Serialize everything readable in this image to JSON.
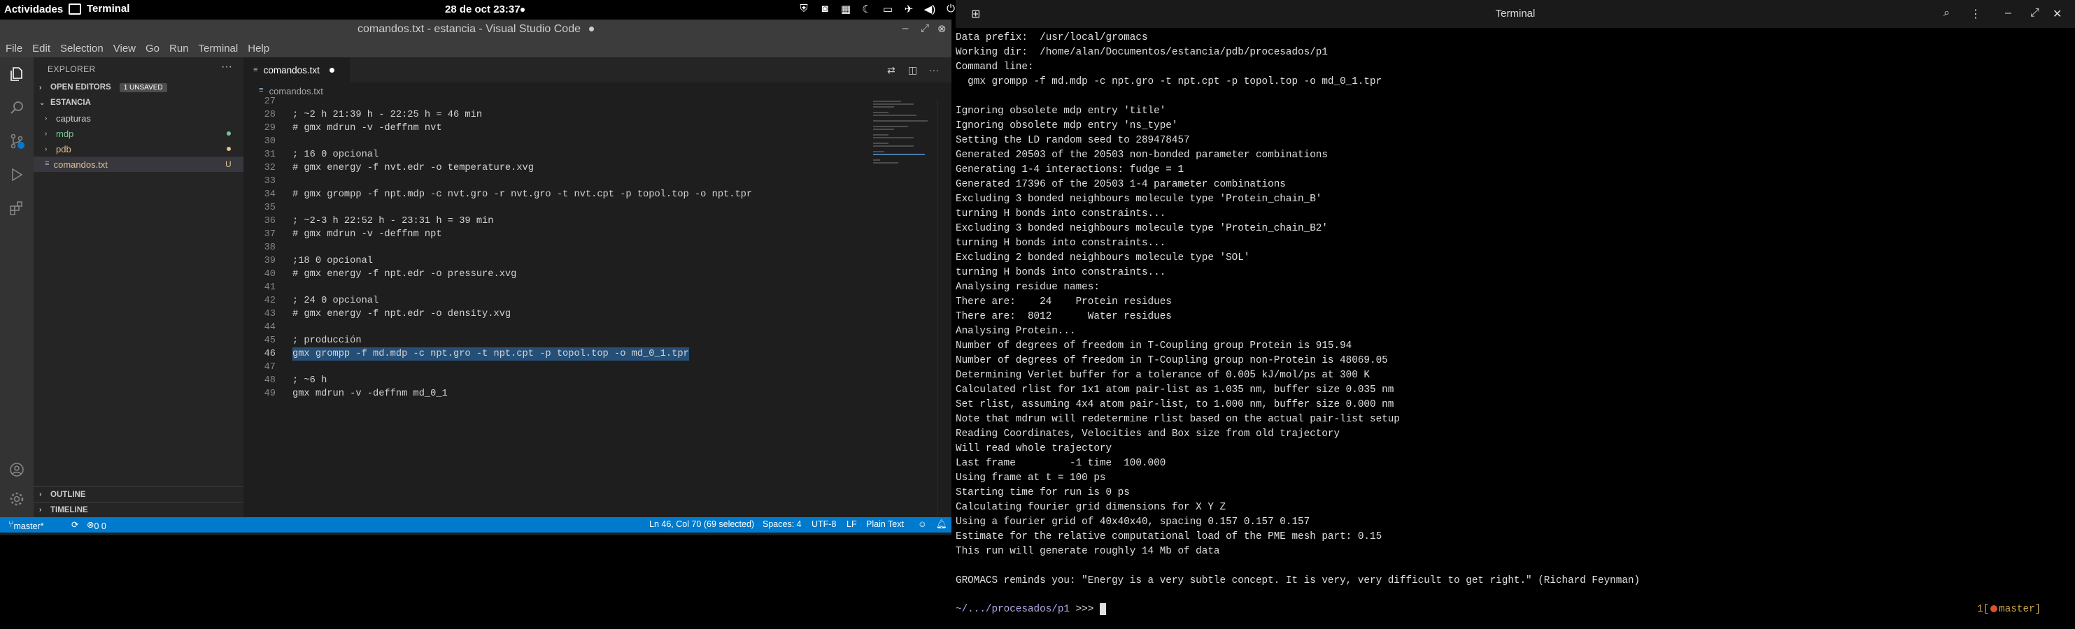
{
  "topbar": {
    "activities": "Actividades",
    "app_name": "Terminal",
    "clock": "28 de oct  23:37"
  },
  "vscode": {
    "title": "comandos.txt - estancia - Visual Studio Code",
    "menu": [
      "File",
      "Edit",
      "Selection",
      "View",
      "Go",
      "Run",
      "Terminal",
      "Help"
    ],
    "sidebar": {
      "header": "EXPLORER",
      "open_editors": "OPEN EDITORS",
      "unsaved_badge": "1 UNSAVED",
      "folder": "ESTANCIA",
      "items": [
        {
          "label": "capturas",
          "type": "folder",
          "color": "#cccccc"
        },
        {
          "label": "mdp",
          "type": "folder",
          "color": "#73c991"
        },
        {
          "label": "pdb",
          "type": "folder",
          "color": "#e2c08d"
        },
        {
          "label": "comandos.txt",
          "type": "file",
          "color": "#e2c08d",
          "mark": "U"
        }
      ],
      "outline": "OUTLINE",
      "timeline": "TIMELINE"
    },
    "tab": {
      "label": "comandos.txt"
    },
    "breadcrumb": "comandos.txt",
    "code_lines": [
      {
        "n": "27",
        "t": ""
      },
      {
        "n": "28",
        "t": "; ~2 h 21:39 h - 22:25 h = 46 min"
      },
      {
        "n": "29",
        "t": "# gmx mdrun -v -deffnm nvt"
      },
      {
        "n": "30",
        "t": ""
      },
      {
        "n": "31",
        "t": "; 16 0 opcional"
      },
      {
        "n": "32",
        "t": "# gmx energy -f nvt.edr -o temperature.xvg"
      },
      {
        "n": "33",
        "t": ""
      },
      {
        "n": "34",
        "t": "# gmx grompp -f npt.mdp -c nvt.gro -r nvt.gro -t nvt.cpt -p topol.top -o npt.tpr"
      },
      {
        "n": "35",
        "t": ""
      },
      {
        "n": "36",
        "t": "; ~2-3 h 22:52 h - 23:31 h = 39 min"
      },
      {
        "n": "37",
        "t": "# gmx mdrun -v -deffnm npt"
      },
      {
        "n": "38",
        "t": ""
      },
      {
        "n": "39",
        "t": ";18 0 opcional"
      },
      {
        "n": "40",
        "t": "# gmx energy -f npt.edr -o pressure.xvg"
      },
      {
        "n": "41",
        "t": ""
      },
      {
        "n": "42",
        "t": "; 24 0 opcional"
      },
      {
        "n": "43",
        "t": "# gmx energy -f npt.edr -o density.xvg"
      },
      {
        "n": "44",
        "t": ""
      },
      {
        "n": "45",
        "t": "; producción"
      },
      {
        "n": "46",
        "t": "gmx grompp -f md.mdp -c npt.gro -t npt.cpt -p topol.top -o md_0_1.tpr"
      },
      {
        "n": "47",
        "t": ""
      },
      {
        "n": "48",
        "t": "; ~6 h"
      },
      {
        "n": "49",
        "t": "gmx mdrun -v -deffnm md_0_1"
      }
    ],
    "status": {
      "branch": "master*",
      "problems": "0  0",
      "position": "Ln 46, Col 70 (69 selected)",
      "spaces": "Spaces: 4",
      "encoding": "UTF-8",
      "eol": "LF",
      "language": "Plain Text"
    }
  },
  "terminal": {
    "title": "Terminal",
    "lines": [
      "Data prefix:  /usr/local/gromacs",
      "Working dir:  /home/alan/Documentos/estancia/pdb/procesados/p1",
      "Command line:",
      "  gmx grompp -f md.mdp -c npt.gro -t npt.cpt -p topol.top -o md_0_1.tpr",
      "",
      "Ignoring obsolete mdp entry 'title'",
      "Ignoring obsolete mdp entry 'ns_type'",
      "Setting the LD random seed to 289478457",
      "Generated 20503 of the 20503 non-bonded parameter combinations",
      "Generating 1-4 interactions: fudge = 1",
      "Generated 17396 of the 20503 1-4 parameter combinations",
      "Excluding 3 bonded neighbours molecule type 'Protein_chain_B'",
      "turning H bonds into constraints...",
      "Excluding 3 bonded neighbours molecule type 'Protein_chain_B2'",
      "turning H bonds into constraints...",
      "Excluding 2 bonded neighbours molecule type 'SOL'",
      "turning H bonds into constraints...",
      "Analysing residue names:",
      "There are:    24    Protein residues",
      "There are:  8012      Water residues",
      "Analysing Protein...",
      "Number of degrees of freedom in T-Coupling group Protein is 915.94",
      "Number of degrees of freedom in T-Coupling group non-Protein is 48069.05",
      "Determining Verlet buffer for a tolerance of 0.005 kJ/mol/ps at 300 K",
      "Calculated rlist for 1x1 atom pair-list as 1.035 nm, buffer size 0.035 nm",
      "Set rlist, assuming 4x4 atom pair-list, to 1.000 nm, buffer size 0.000 nm",
      "Note that mdrun will redetermine rlist based on the actual pair-list setup",
      "Reading Coordinates, Velocities and Box size from old trajectory",
      "Will read whole trajectory",
      "Last frame         -1 time  100.000",
      "Using frame at t = 100 ps",
      "Starting time for run is 0 ps",
      "Calculating fourier grid dimensions for X Y Z",
      "Using a fourier grid of 40x40x40, spacing 0.157 0.157 0.157",
      "Estimate for the relative computational load of the PME mesh part: 0.15",
      "This run will generate roughly 14 Mb of data",
      "",
      "GROMACS reminds you: \"Energy is a very subtle concept. It is very, very difficult to get right.\" (Richard Feynman)"
    ],
    "prompt_path": "~/.../procesados/p1",
    "prompt_symbol": " >>> ",
    "branch_open": "1[",
    "branch_name": "master]"
  }
}
